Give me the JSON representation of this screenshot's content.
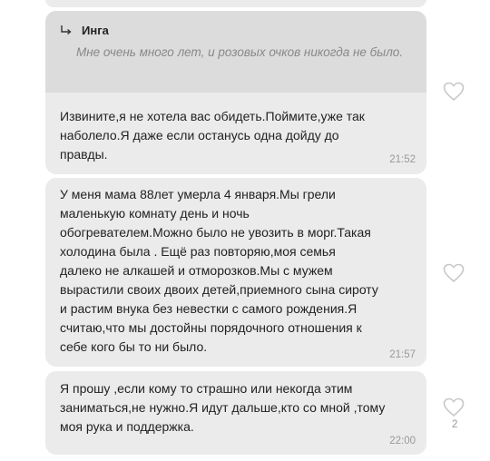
{
  "messages": [
    {
      "quote": {
        "author": "Инга",
        "text": "Мне очень много лет, и розовых очков никогда не было."
      },
      "text": "Извините,я не хотела вас обидеть.Поймите,уже так\nнаболело.Я даже если останусь одна дойду до\nправды.",
      "time": "21:52",
      "likes": null
    },
    {
      "text": "У меня мама 88лет умерла 4 января.Мы грели\nмаленькую комнату день и ночь\nобогревателем.Можно было не увозить в морг.Такая\nхолодина  была . Ещё раз повторяю,моя семья\nдалеко не алкашей  и  отморозков.Мы с мужем\nвырастили своих двоих детей,приемного сына сироту\nи растим внука без невестки с самого рождения.Я\nсчитаю,что мы достойны порядочного отношения к\nсебе кого бы то ни было.",
      "time": "21:57",
      "likes": null
    },
    {
      "text": "Я прошу ,если кому то страшно или некогда этим\nзаниматься,не нужно.Я идут дальше,кто со мной ,тому\nмоя рука и поддержка.",
      "time": "22:00",
      "likes": "2"
    }
  ],
  "icons": {
    "reply": "reply-arrow-icon",
    "like": "heart-outline-icon"
  },
  "colors": {
    "bubble": "#ebebeb",
    "quote_bg": "#dcdcdc",
    "quote_text": "#888888",
    "time": "#999999",
    "heart": "#c8c8c8"
  }
}
